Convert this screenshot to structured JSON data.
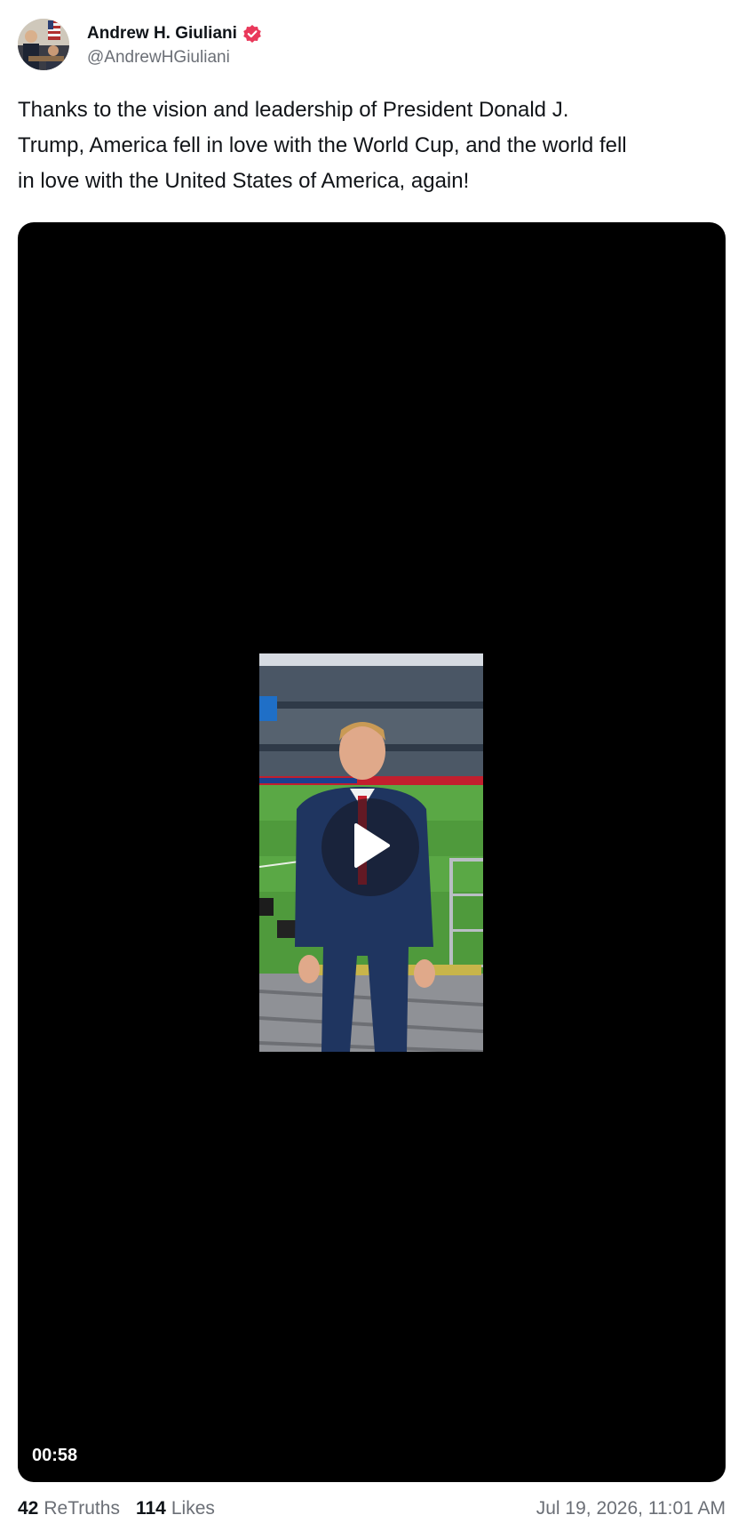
{
  "author": {
    "display_name": "Andrew H. Giuliani",
    "handle": "@AndrewHGiuliani",
    "verified_icon": "verified-badge-icon",
    "badge_color": "#e9385a"
  },
  "post": {
    "text": "Thanks to the vision and leadership of President Donald J.\nTrump, America fell in love with the World Cup, and the world fell\nin love with the United States of America, again!"
  },
  "video": {
    "duration": "00:58",
    "play_icon": "play-icon"
  },
  "stats": {
    "retruths_count": "42",
    "retruths_label": "ReTruths",
    "likes_count": "114",
    "likes_label": "Likes"
  },
  "timestamp": "Jul 19, 2026, 11:01 AM"
}
